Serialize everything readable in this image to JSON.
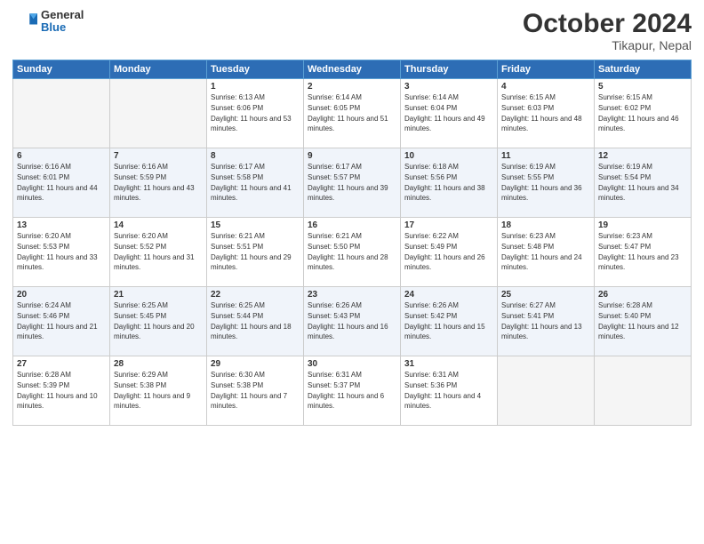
{
  "logo": {
    "general": "General",
    "blue": "Blue"
  },
  "title": "October 2024",
  "location": "Tikapur, Nepal",
  "header_days": [
    "Sunday",
    "Monday",
    "Tuesday",
    "Wednesday",
    "Thursday",
    "Friday",
    "Saturday"
  ],
  "weeks": [
    [
      {
        "day": "",
        "sunrise": "",
        "sunset": "",
        "daylight": ""
      },
      {
        "day": "",
        "sunrise": "",
        "sunset": "",
        "daylight": ""
      },
      {
        "day": "1",
        "sunrise": "Sunrise: 6:13 AM",
        "sunset": "Sunset: 6:06 PM",
        "daylight": "Daylight: 11 hours and 53 minutes."
      },
      {
        "day": "2",
        "sunrise": "Sunrise: 6:14 AM",
        "sunset": "Sunset: 6:05 PM",
        "daylight": "Daylight: 11 hours and 51 minutes."
      },
      {
        "day": "3",
        "sunrise": "Sunrise: 6:14 AM",
        "sunset": "Sunset: 6:04 PM",
        "daylight": "Daylight: 11 hours and 49 minutes."
      },
      {
        "day": "4",
        "sunrise": "Sunrise: 6:15 AM",
        "sunset": "Sunset: 6:03 PM",
        "daylight": "Daylight: 11 hours and 48 minutes."
      },
      {
        "day": "5",
        "sunrise": "Sunrise: 6:15 AM",
        "sunset": "Sunset: 6:02 PM",
        "daylight": "Daylight: 11 hours and 46 minutes."
      }
    ],
    [
      {
        "day": "6",
        "sunrise": "Sunrise: 6:16 AM",
        "sunset": "Sunset: 6:01 PM",
        "daylight": "Daylight: 11 hours and 44 minutes."
      },
      {
        "day": "7",
        "sunrise": "Sunrise: 6:16 AM",
        "sunset": "Sunset: 5:59 PM",
        "daylight": "Daylight: 11 hours and 43 minutes."
      },
      {
        "day": "8",
        "sunrise": "Sunrise: 6:17 AM",
        "sunset": "Sunset: 5:58 PM",
        "daylight": "Daylight: 11 hours and 41 minutes."
      },
      {
        "day": "9",
        "sunrise": "Sunrise: 6:17 AM",
        "sunset": "Sunset: 5:57 PM",
        "daylight": "Daylight: 11 hours and 39 minutes."
      },
      {
        "day": "10",
        "sunrise": "Sunrise: 6:18 AM",
        "sunset": "Sunset: 5:56 PM",
        "daylight": "Daylight: 11 hours and 38 minutes."
      },
      {
        "day": "11",
        "sunrise": "Sunrise: 6:19 AM",
        "sunset": "Sunset: 5:55 PM",
        "daylight": "Daylight: 11 hours and 36 minutes."
      },
      {
        "day": "12",
        "sunrise": "Sunrise: 6:19 AM",
        "sunset": "Sunset: 5:54 PM",
        "daylight": "Daylight: 11 hours and 34 minutes."
      }
    ],
    [
      {
        "day": "13",
        "sunrise": "Sunrise: 6:20 AM",
        "sunset": "Sunset: 5:53 PM",
        "daylight": "Daylight: 11 hours and 33 minutes."
      },
      {
        "day": "14",
        "sunrise": "Sunrise: 6:20 AM",
        "sunset": "Sunset: 5:52 PM",
        "daylight": "Daylight: 11 hours and 31 minutes."
      },
      {
        "day": "15",
        "sunrise": "Sunrise: 6:21 AM",
        "sunset": "Sunset: 5:51 PM",
        "daylight": "Daylight: 11 hours and 29 minutes."
      },
      {
        "day": "16",
        "sunrise": "Sunrise: 6:21 AM",
        "sunset": "Sunset: 5:50 PM",
        "daylight": "Daylight: 11 hours and 28 minutes."
      },
      {
        "day": "17",
        "sunrise": "Sunrise: 6:22 AM",
        "sunset": "Sunset: 5:49 PM",
        "daylight": "Daylight: 11 hours and 26 minutes."
      },
      {
        "day": "18",
        "sunrise": "Sunrise: 6:23 AM",
        "sunset": "Sunset: 5:48 PM",
        "daylight": "Daylight: 11 hours and 24 minutes."
      },
      {
        "day": "19",
        "sunrise": "Sunrise: 6:23 AM",
        "sunset": "Sunset: 5:47 PM",
        "daylight": "Daylight: 11 hours and 23 minutes."
      }
    ],
    [
      {
        "day": "20",
        "sunrise": "Sunrise: 6:24 AM",
        "sunset": "Sunset: 5:46 PM",
        "daylight": "Daylight: 11 hours and 21 minutes."
      },
      {
        "day": "21",
        "sunrise": "Sunrise: 6:25 AM",
        "sunset": "Sunset: 5:45 PM",
        "daylight": "Daylight: 11 hours and 20 minutes."
      },
      {
        "day": "22",
        "sunrise": "Sunrise: 6:25 AM",
        "sunset": "Sunset: 5:44 PM",
        "daylight": "Daylight: 11 hours and 18 minutes."
      },
      {
        "day": "23",
        "sunrise": "Sunrise: 6:26 AM",
        "sunset": "Sunset: 5:43 PM",
        "daylight": "Daylight: 11 hours and 16 minutes."
      },
      {
        "day": "24",
        "sunrise": "Sunrise: 6:26 AM",
        "sunset": "Sunset: 5:42 PM",
        "daylight": "Daylight: 11 hours and 15 minutes."
      },
      {
        "day": "25",
        "sunrise": "Sunrise: 6:27 AM",
        "sunset": "Sunset: 5:41 PM",
        "daylight": "Daylight: 11 hours and 13 minutes."
      },
      {
        "day": "26",
        "sunrise": "Sunrise: 6:28 AM",
        "sunset": "Sunset: 5:40 PM",
        "daylight": "Daylight: 11 hours and 12 minutes."
      }
    ],
    [
      {
        "day": "27",
        "sunrise": "Sunrise: 6:28 AM",
        "sunset": "Sunset: 5:39 PM",
        "daylight": "Daylight: 11 hours and 10 minutes."
      },
      {
        "day": "28",
        "sunrise": "Sunrise: 6:29 AM",
        "sunset": "Sunset: 5:38 PM",
        "daylight": "Daylight: 11 hours and 9 minutes."
      },
      {
        "day": "29",
        "sunrise": "Sunrise: 6:30 AM",
        "sunset": "Sunset: 5:38 PM",
        "daylight": "Daylight: 11 hours and 7 minutes."
      },
      {
        "day": "30",
        "sunrise": "Sunrise: 6:31 AM",
        "sunset": "Sunset: 5:37 PM",
        "daylight": "Daylight: 11 hours and 6 minutes."
      },
      {
        "day": "31",
        "sunrise": "Sunrise: 6:31 AM",
        "sunset": "Sunset: 5:36 PM",
        "daylight": "Daylight: 11 hours and 4 minutes."
      },
      {
        "day": "",
        "sunrise": "",
        "sunset": "",
        "daylight": ""
      },
      {
        "day": "",
        "sunrise": "",
        "sunset": "",
        "daylight": ""
      }
    ]
  ]
}
